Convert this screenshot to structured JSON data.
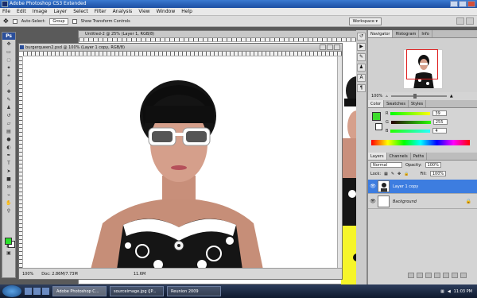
{
  "app": {
    "title": "Adobe Photoshop CS3 Extended"
  },
  "menu": [
    "File",
    "Edit",
    "Image",
    "Layer",
    "Select",
    "Filter",
    "Analysis",
    "View",
    "Window",
    "Help"
  ],
  "options": {
    "auto_select_label": "Auto-Select:",
    "auto_select_value": "Group",
    "transform_label": "Show Transform Controls",
    "workspace_label": "Workspace ▾"
  },
  "doc_back": {
    "title": "Untitled-2 @ 25% (Layer 1, RGB/8)"
  },
  "doc_front": {
    "title": "burgerqueen2.psd @ 100% (Layer 1 copy, RGB/8)",
    "zoom": "100%",
    "doc_info": "Doc: 2.86M/7.73M",
    "back_status": "11.6M"
  },
  "navigator": {
    "tabs": [
      "Navigator",
      "Histogram",
      "Info"
    ],
    "zoom": "100%"
  },
  "color": {
    "tabs": [
      "Color",
      "Swatches",
      "Styles"
    ],
    "fg": "#3ddc2c",
    "r_label": "R",
    "r_value": "39",
    "g_label": "G",
    "g_value": "255",
    "b_label": "B",
    "b_value": "4"
  },
  "layers": {
    "tabs": [
      "Layers",
      "Channels",
      "Paths"
    ],
    "blend_mode": "Normal",
    "opacity_label": "Opacity:",
    "opacity_value": "100%",
    "lock_label": "Lock:",
    "fill_label": "Fill:",
    "fill_value": "100%",
    "items": [
      {
        "name": "Layer 1 copy",
        "active": true
      },
      {
        "name": "Background",
        "active": false
      }
    ]
  },
  "taskbar": {
    "items": [
      "Adobe Photoshop C...",
      "sourceimage.jpg (JP...",
      "Reunion 2009"
    ],
    "time": "11:03 PM"
  }
}
